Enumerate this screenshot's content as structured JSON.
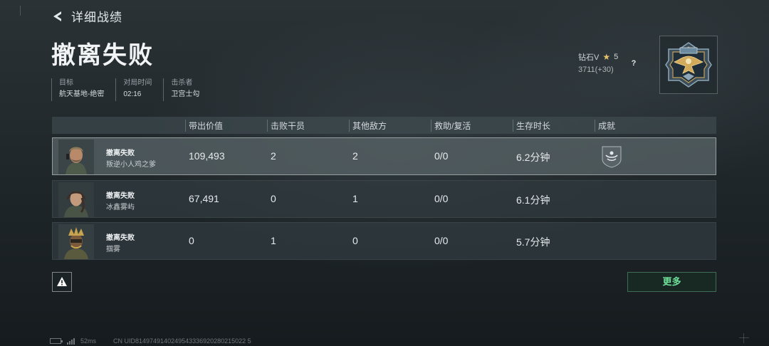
{
  "header": {
    "back_title": "详细战绩",
    "result_title": "撤离失败"
  },
  "meta": [
    {
      "label": "目标",
      "value": "航天基地-绝密"
    },
    {
      "label": "对局时间",
      "value": "02:16"
    },
    {
      "label": "击杀者",
      "value": "卫宫士勾"
    }
  ],
  "rank": {
    "tier": "钻石V",
    "stars": "5",
    "score": "3711(+30)",
    "help": "?"
  },
  "table": {
    "headers": {
      "value": "带出价值",
      "kills": "击败干员",
      "other": "其他敌方",
      "assist": "救助/复活",
      "survival": "生存时长",
      "achievement": "成就"
    },
    "rows": [
      {
        "status": "撤离失败",
        "name": "叛逆小人鸡之爹",
        "value": "109,493",
        "kills": "2",
        "other": "2",
        "assist": "0/0",
        "survival": "6.2分钟",
        "self": true,
        "has_achievement": true
      },
      {
        "status": "撤离失败",
        "name": "冰鑫雾屿",
        "value": "67,491",
        "kills": "0",
        "other": "1",
        "assist": "0/0",
        "survival": "6.1分钟",
        "self": false,
        "has_achievement": false
      },
      {
        "status": "撤离失败",
        "name": "掴雾",
        "value": "0",
        "kills": "1",
        "other": "0",
        "assist": "0/0",
        "survival": "5.7分钟",
        "self": false,
        "has_achievement": false
      }
    ]
  },
  "buttons": {
    "more": "更多"
  },
  "footer": {
    "ping": "52ms",
    "uid": "CN UID8149749140249543336920280215022 5"
  },
  "colors": {
    "accent_green": "#6fe09a",
    "star_gold": "#e3c46a"
  }
}
